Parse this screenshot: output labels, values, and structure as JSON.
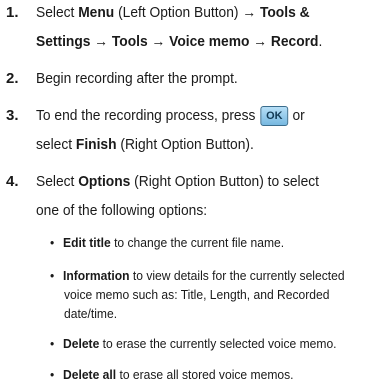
{
  "steps": [
    {
      "number": "1.",
      "line1": {
        "a": "Select ",
        "b1": "Menu",
        "c": " (Left Option Button) → ",
        "b2": "Tools &"
      },
      "line2": {
        "b1": "Settings → Tools → Voice memo → Record",
        "c": "."
      }
    },
    {
      "number": "2.",
      "line1": "Begin recording after the prompt."
    },
    {
      "number": "3.",
      "line1": {
        "a": "To end the recording process, press ",
        "key": "OK",
        "c": " or"
      },
      "line2": {
        "a": "select ",
        "b": "Finish",
        "c": " (Right Option Button)."
      }
    },
    {
      "number": "4.",
      "line1": {
        "a": "Select ",
        "b": "Options",
        "c": " (Right Option Button) to select"
      },
      "line2": "one of the following options:"
    }
  ],
  "options": [
    {
      "bold": "Edit title",
      "text": " to change the current file name."
    },
    {
      "bold": "Information",
      "text": " to view details for the currently selected",
      "extra": [
        "voice memo such as: Title, Length, and Recorded",
        "date/time."
      ]
    },
    {
      "bold": "Delete",
      "text": " to erase the currently selected voice memo."
    },
    {
      "bold": "Delete all",
      "text": " to erase all stored voice memos."
    }
  ],
  "bullet_char": "•"
}
